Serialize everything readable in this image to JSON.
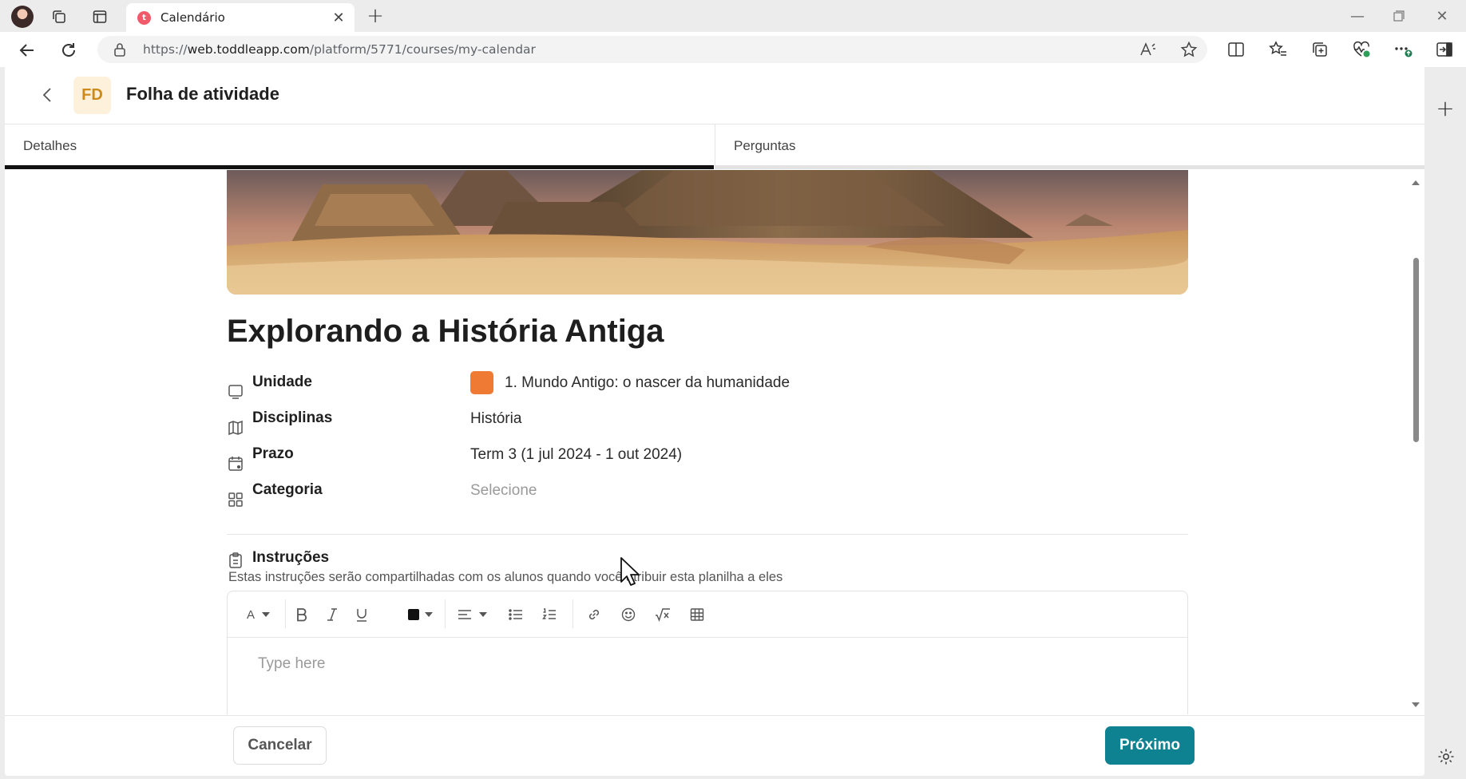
{
  "browser": {
    "tab_title": "Calendário",
    "favicon_letter": "t",
    "url_prefix": "https://",
    "url_domain": "web.toddleapp.com",
    "url_path": "/platform/5771/courses/my-calendar"
  },
  "header": {
    "badge": "FD",
    "title": "Folha de atividade"
  },
  "tabs": [
    {
      "label": "Detalhes",
      "active": true
    },
    {
      "label": "Perguntas",
      "active": false
    }
  ],
  "page": {
    "title": "Explorando a História Antiga"
  },
  "details": [
    {
      "label": "Unidade",
      "value": "1. Mundo Antigo: o nascer da humanidade",
      "icon": "book-icon",
      "chip_color": "#ef7a34"
    },
    {
      "label": "Disciplinas",
      "value": "História",
      "icon": "books-icon"
    },
    {
      "label": "Prazo",
      "value": "Term 3 (1 jul 2024 - 1 out 2024)",
      "icon": "calendar-icon"
    },
    {
      "label": "Categoria",
      "value": "Selecione",
      "icon": "grid-icon",
      "is_placeholder": true
    }
  ],
  "instructions": {
    "label": "Instruções",
    "hint": "Estas instruções serão compartilhadas com os alunos quando você atribuir esta planilha a eles",
    "editor_placeholder": "Type here",
    "font_glyph": "A"
  },
  "footer": {
    "cancel_label": "Cancelar",
    "next_label": "Próximo"
  },
  "colors": {
    "accent": "#0f8291",
    "unit_chip": "#ef7a34",
    "tab_favicon": "#f05a6b"
  }
}
